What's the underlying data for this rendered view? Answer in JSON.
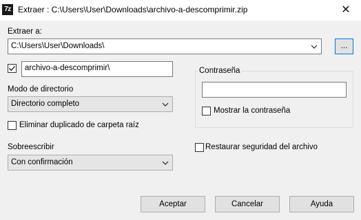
{
  "window": {
    "icon_text": "7z",
    "title": "Extraer : C:\\Users\\User\\Downloads\\archivo-a-descomprimir.zip",
    "close_glyph": "✕"
  },
  "extract_to": {
    "label": "Extraer a:",
    "path": "C:\\Users\\User\\Downloads\\",
    "browse_label": "..."
  },
  "subfolder": {
    "checked": true,
    "value": "archivo-a-descomprimir\\"
  },
  "path_mode": {
    "label": "Modo de directorio",
    "selected": "Directorio completo"
  },
  "eliminate_duplicate": {
    "label": "Eliminar duplicado de carpeta raíz",
    "checked": false
  },
  "overwrite": {
    "label": "Sobreescribir",
    "selected": "Con confirmación"
  },
  "password": {
    "group_label": "Contraseña",
    "value": "",
    "show_label": "Mostrar la contraseña",
    "show_checked": false
  },
  "restore_security": {
    "label": "Restaurar seguridad del archivo",
    "checked": false
  },
  "buttons": {
    "ok": "Aceptar",
    "cancel": "Cancelar",
    "help": "Ayuda"
  },
  "colors": {
    "background": "#f0f0f0",
    "focus_border": "#0078d7"
  },
  "icons": [
    "app-7zip-icon",
    "close-icon",
    "chevron-down-icon",
    "checkmark-icon"
  ]
}
